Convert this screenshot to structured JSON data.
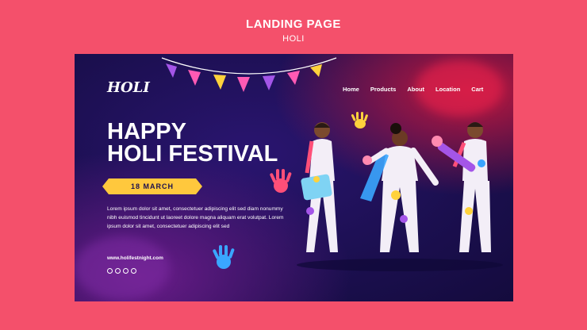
{
  "header": {
    "title": "LANDING PAGE",
    "subtitle": "HOLI"
  },
  "page": {
    "logo": "HOLI",
    "nav": [
      {
        "label": "Home"
      },
      {
        "label": "Products"
      },
      {
        "label": "About"
      },
      {
        "label": "Location"
      },
      {
        "label": "Cart"
      }
    ],
    "headline": {
      "line1": "HAPPY",
      "line2": "HOLI FESTIVAL"
    },
    "date": "18 MARCH",
    "body": "Lorem ipsum dolor sit amet, consectetuer adipiscing elit sed diam nonummy nibh euismod tincidunt ut laoreet dolore magna aliquam erat volutpat. Lorem ipsum dolor sit amet, consectetuer adipiscing elit sed",
    "website": "www.holifestnight.com",
    "social_icons": [
      "instagram-icon",
      "facebook-icon",
      "twitter-icon",
      "pinterest-icon"
    ]
  },
  "colors": {
    "background": "#f4506b",
    "card": "#1b0f4f",
    "accent": "#ffc83d"
  }
}
